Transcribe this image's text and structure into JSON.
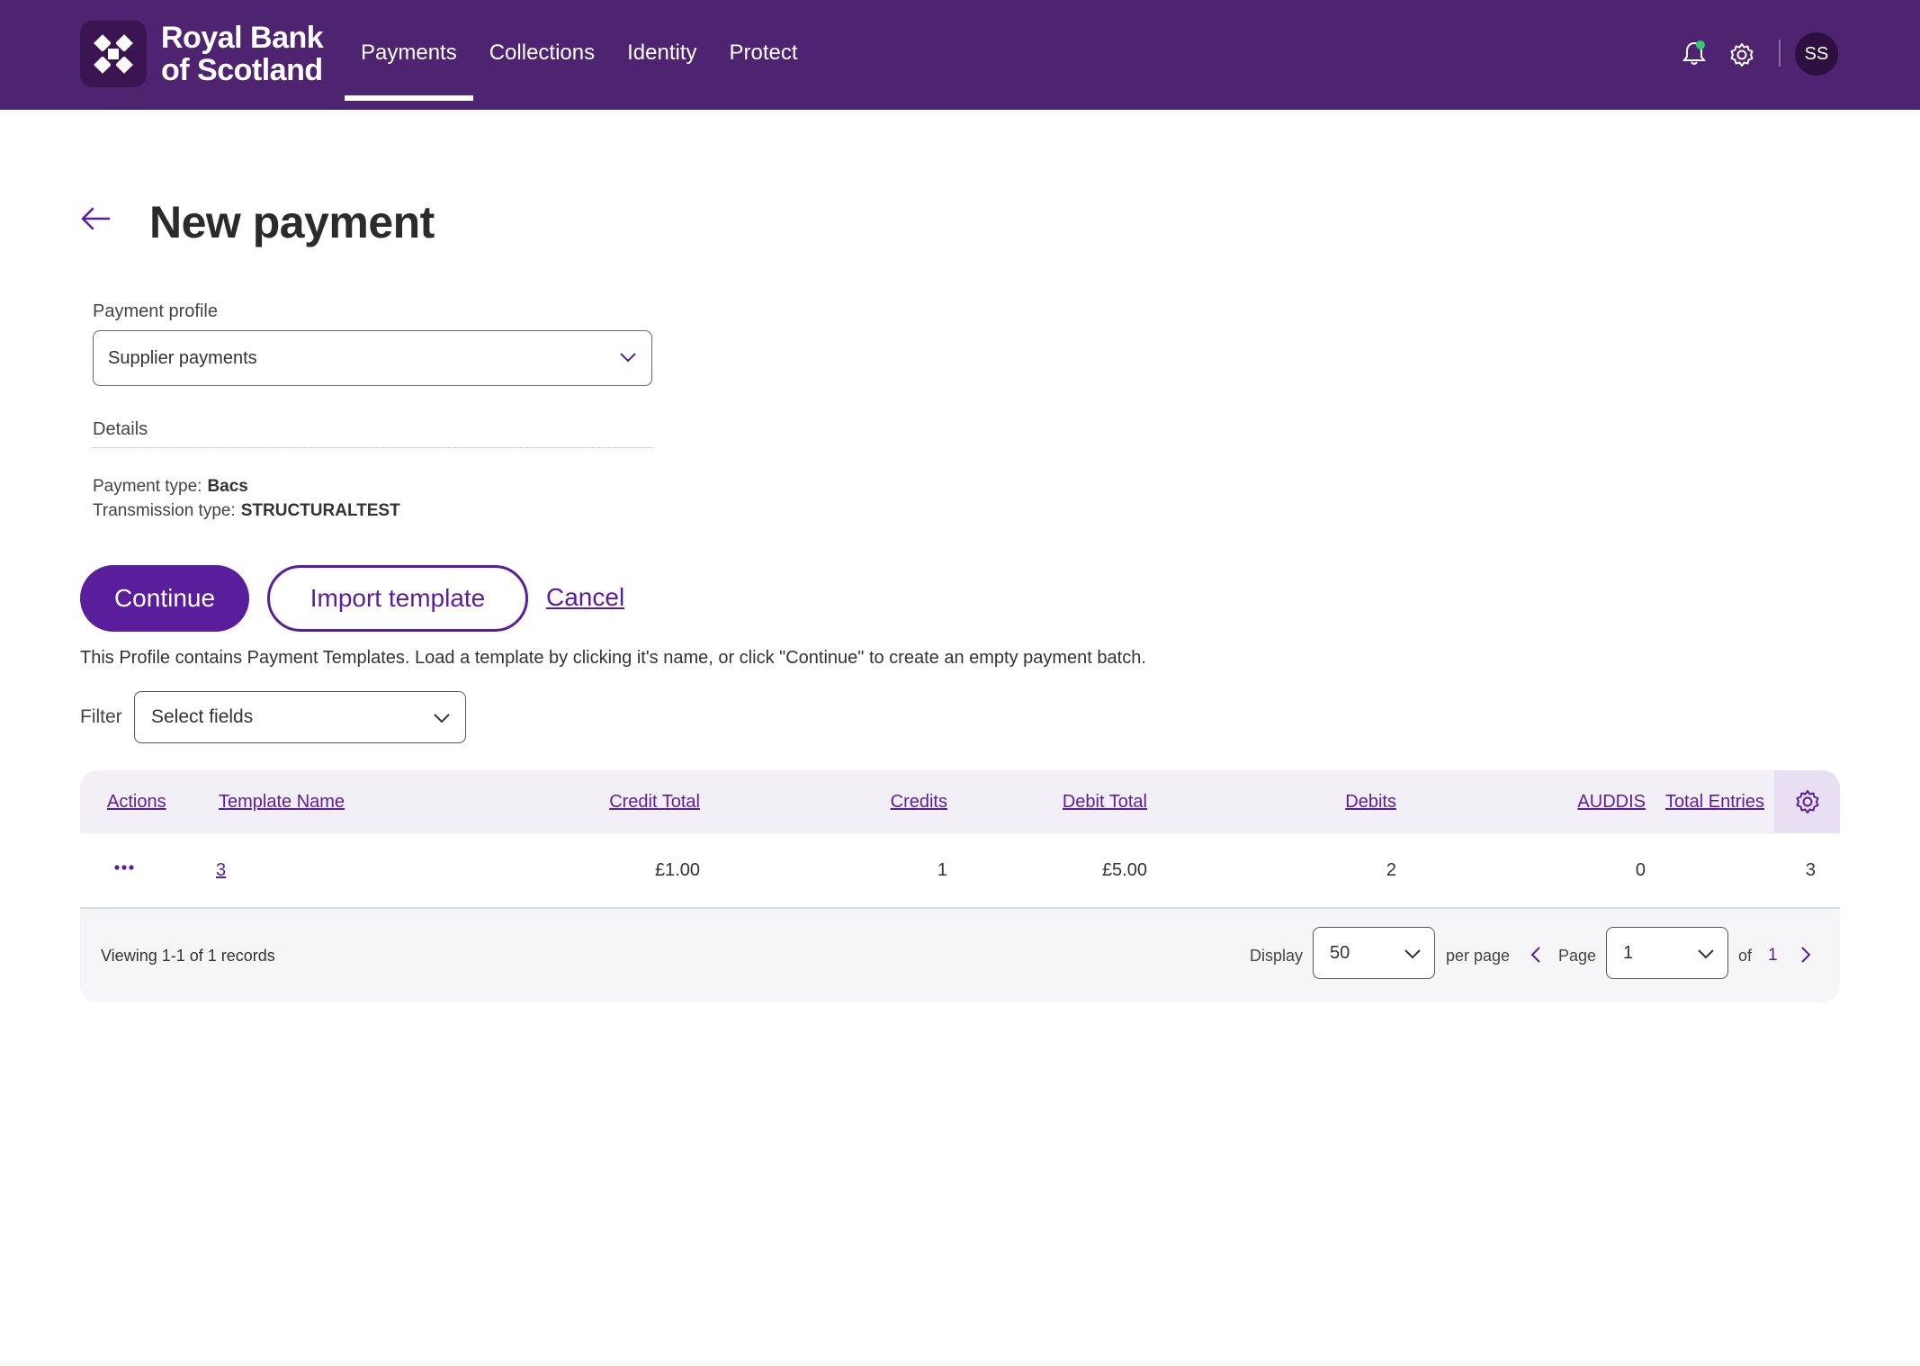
{
  "brand": {
    "line1": "Royal Bank",
    "line2": "of Scotland",
    "logo_icon": "rbs-daisy-logo-icon"
  },
  "nav": {
    "items": [
      {
        "label": "Payments",
        "active": true
      },
      {
        "label": "Collections",
        "active": false
      },
      {
        "label": "Identity",
        "active": false
      },
      {
        "label": "Protect",
        "active": false
      }
    ]
  },
  "header": {
    "avatar_initials": "SS",
    "notification_dot_color": "#2ecc71"
  },
  "page": {
    "title": "New payment"
  },
  "form": {
    "profile_label": "Payment profile",
    "profile_value": "Supplier payments",
    "details_label": "Details",
    "payment_type_label": "Payment type:",
    "payment_type_value": "Bacs",
    "transmission_type_label": "Transmission type:",
    "transmission_type_value": "STRUCTURALTEST"
  },
  "actions": {
    "continue_label": "Continue",
    "import_label": "Import template",
    "cancel_label": "Cancel"
  },
  "info_text": "This Profile contains Payment Templates. Load a template by clicking it's name, or click \"Continue\" to create an empty payment batch.",
  "filter": {
    "label": "Filter",
    "value": "Select fields"
  },
  "table": {
    "headers": {
      "actions": "Actions",
      "template_name": "Template Name",
      "credit_total": "Credit Total",
      "credits": "Credits",
      "debit_total": "Debit Total",
      "debits": "Debits",
      "auddis": "AUDDIS",
      "total_entries": "Total Entries"
    },
    "rows": [
      {
        "template_name": "3",
        "credit_total": "£1.00",
        "credits": "1",
        "debit_total": "£5.00",
        "debits": "2",
        "auddis": "0",
        "total_entries": "3"
      }
    ]
  },
  "pagination": {
    "viewing": "Viewing 1-1 of 1 records",
    "display_label": "Display",
    "per_page_value": "50",
    "per_page_label": "per page",
    "page_label": "Page",
    "page_value": "1",
    "of_label": "of",
    "total_pages": "1"
  },
  "colors": {
    "header_bg": "#4e2370",
    "accent": "#5a1e9c"
  }
}
